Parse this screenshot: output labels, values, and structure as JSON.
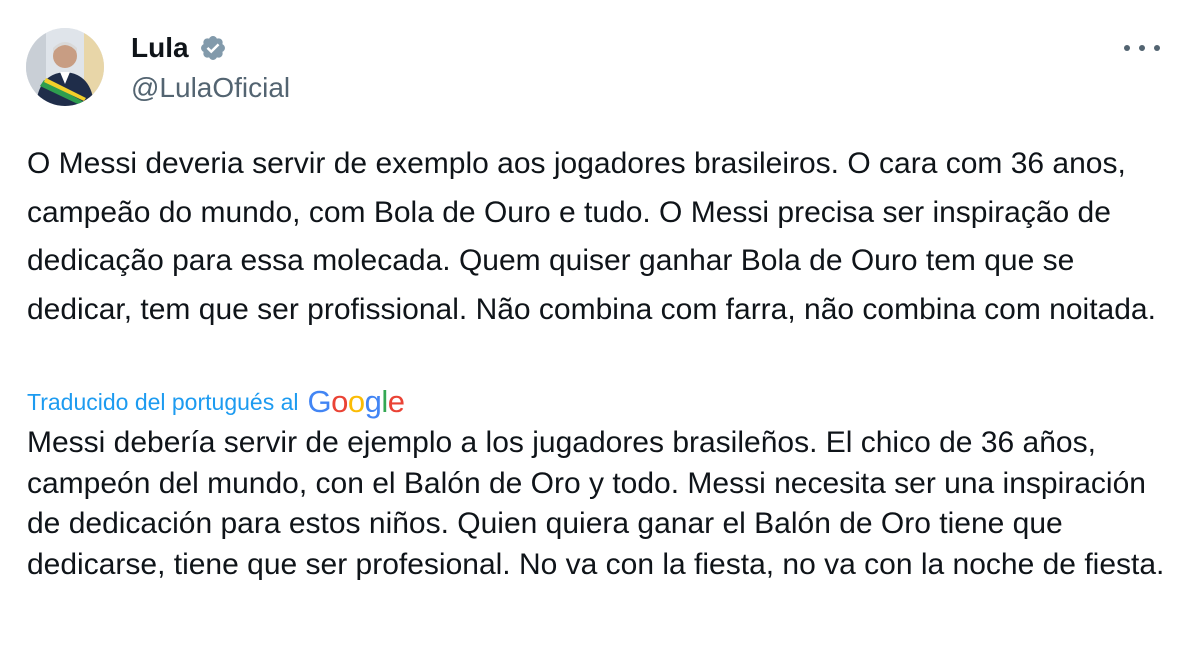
{
  "author": {
    "display_name": "Lula",
    "handle": "@LulaOficial",
    "verified_icon": "verified-badge-icon"
  },
  "actions": {
    "more_icon": "more-options-icon"
  },
  "tweet": {
    "text": "O Messi deveria servir de exemplo aos jogadores brasileiros. O cara com 36 anos, campeão do mundo, com Bola de Ouro e tudo. O Messi precisa ser inspiração de dedicação para essa molecada. Quem quiser ganhar Bola de Ouro tem que se dedicar, tem que ser profissional. Não combina com farra, não combina com noitada."
  },
  "translation": {
    "label": "Traducido del portugués al",
    "provider": "Google",
    "text": "Messi debería servir de ejemplo a los jugadores brasileños. El chico de 36 años, campeón del mundo, con el Balón de Oro y todo. Messi necesita ser una inspiración de dedicación para estos niños. Quien quiera ganar el Balón de Oro tiene que dedicarse, tiene que ser profesional. No va con la fiesta, no va con la noche de fiesta."
  },
  "colors": {
    "link_blue": "#1d9bf0",
    "text_primary": "#0f1419",
    "text_secondary": "#536471",
    "google_blue": "#4285f4",
    "google_red": "#ea4335",
    "google_yellow": "#fbbc05",
    "google_green": "#34a853"
  }
}
